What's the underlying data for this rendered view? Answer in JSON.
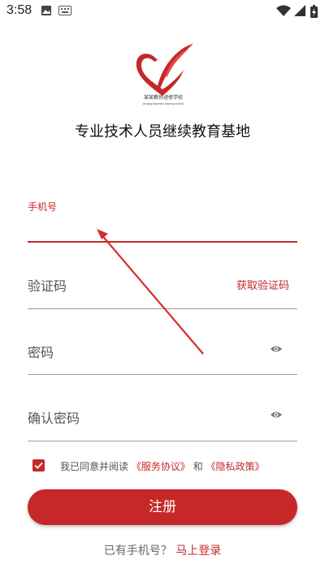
{
  "status_bar": {
    "time": "3:58",
    "icons": [
      "image-icon",
      "keyboard-icon",
      "wifi-icon",
      "signal-icon",
      "battery-icon"
    ]
  },
  "logo": {
    "text_cn": "某某教师进修学校",
    "text_en": "Anqing teachers training school"
  },
  "tagline": "专业技术人员继续教育基地",
  "form": {
    "phone": {
      "label": "手机号",
      "value": ""
    },
    "code": {
      "placeholder": "验证码",
      "get_code_label": "获取验证码"
    },
    "password": {
      "placeholder": "密码"
    },
    "confirm_password": {
      "placeholder": "确认密码"
    }
  },
  "agreement": {
    "checked": true,
    "prefix": "我已同意并阅读",
    "service_link": "《服务协议》",
    "and": "和",
    "privacy_link": "《隐私政策》"
  },
  "register_button": "注册",
  "login_prompt": {
    "text": "已有手机号？",
    "link": "马上登录"
  },
  "colors": {
    "accent": "#c62828",
    "divider": "#9e9e9e"
  }
}
